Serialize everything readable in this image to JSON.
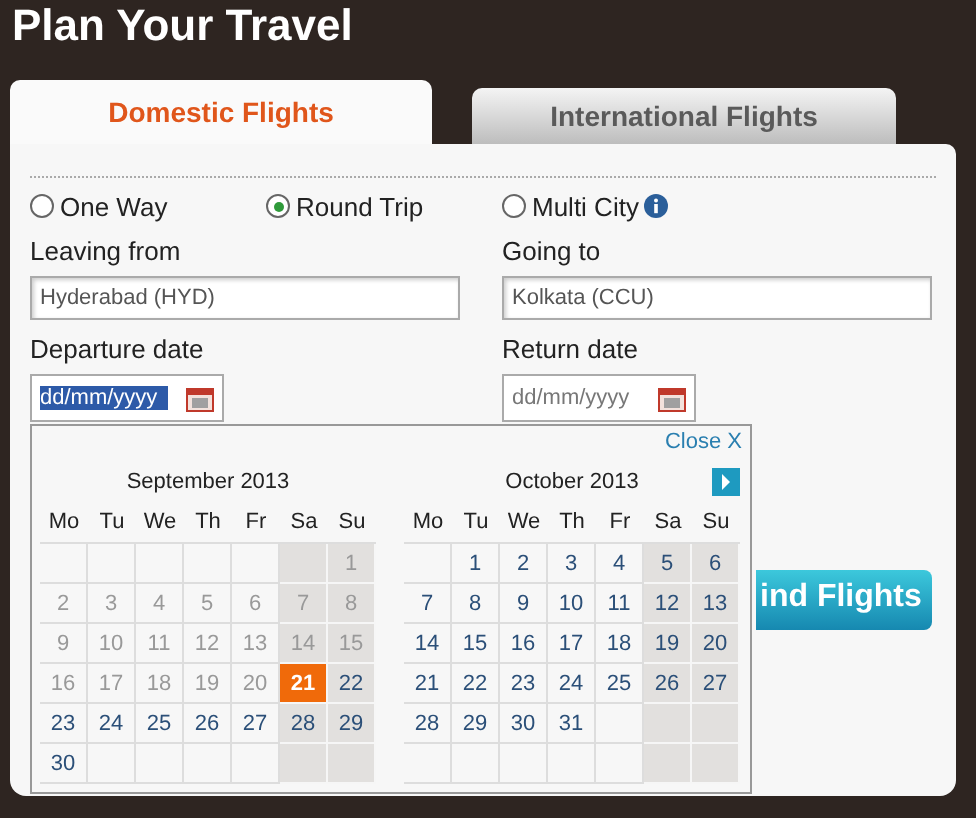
{
  "title": "Plan Your Travel",
  "tabs": [
    {
      "label": "Domestic Flights",
      "selected": true
    },
    {
      "label": "International Flights",
      "selected": false
    }
  ],
  "trip_types": [
    {
      "label": "One Way",
      "selected": false,
      "info": false
    },
    {
      "label": "Round Trip",
      "selected": true,
      "info": false
    },
    {
      "label": "Multi City",
      "selected": false,
      "info": true
    }
  ],
  "fields": [
    {
      "label": "Leaving from",
      "value": "Hyderabad (HYD)"
    },
    {
      "label": "Going to",
      "value": "Kolkata (CCU)"
    }
  ],
  "dates": [
    {
      "label": "Departure date",
      "placeholder": "dd/mm/yyyy",
      "focused": true
    },
    {
      "label": "Return date",
      "placeholder": "dd/mm/yyyy",
      "focused": false
    }
  ],
  "search_button": "ind Flights",
  "calendar": {
    "close": "Close X",
    "months": [
      {
        "title": "September 2013",
        "next": false,
        "weekdays": [
          "Mo",
          "Tu",
          "We",
          "Th",
          "Fr",
          "Sa",
          "Su"
        ],
        "weeks": [
          [
            {
              "kind": "blank"
            },
            {
              "kind": "blank"
            },
            {
              "kind": "blank"
            },
            {
              "kind": "blank"
            },
            {
              "kind": "blank"
            },
            {
              "kind": "blank"
            },
            {
              "day": "1",
              "kind": "past"
            }
          ],
          [
            {
              "day": "2",
              "kind": "past"
            },
            {
              "day": "3",
              "kind": "past"
            },
            {
              "day": "4",
              "kind": "past"
            },
            {
              "day": "5",
              "kind": "past"
            },
            {
              "day": "6",
              "kind": "past"
            },
            {
              "day": "7",
              "kind": "past"
            },
            {
              "day": "8",
              "kind": "past"
            }
          ],
          [
            {
              "day": "9",
              "kind": "past"
            },
            {
              "day": "10",
              "kind": "past"
            },
            {
              "day": "11",
              "kind": "past"
            },
            {
              "day": "12",
              "kind": "past"
            },
            {
              "day": "13",
              "kind": "past"
            },
            {
              "day": "14",
              "kind": "past"
            },
            {
              "day": "15",
              "kind": "past"
            }
          ],
          [
            {
              "day": "16",
              "kind": "past"
            },
            {
              "day": "17",
              "kind": "past"
            },
            {
              "day": "18",
              "kind": "past"
            },
            {
              "day": "19",
              "kind": "past"
            },
            {
              "day": "20",
              "kind": "past"
            },
            {
              "day": "21",
              "kind": "selected"
            },
            {
              "day": "22",
              "kind": "open"
            }
          ],
          [
            {
              "day": "23",
              "kind": "open"
            },
            {
              "day": "24",
              "kind": "open"
            },
            {
              "day": "25",
              "kind": "open"
            },
            {
              "day": "26",
              "kind": "open"
            },
            {
              "day": "27",
              "kind": "open"
            },
            {
              "day": "28",
              "kind": "open"
            },
            {
              "day": "29",
              "kind": "open"
            }
          ],
          [
            {
              "day": "30",
              "kind": "open"
            },
            {
              "kind": "blank"
            },
            {
              "kind": "blank"
            },
            {
              "kind": "blank"
            },
            {
              "kind": "blank"
            },
            {
              "kind": "blank"
            },
            {
              "kind": "blank"
            }
          ]
        ]
      },
      {
        "title": "October 2013",
        "next": true,
        "weekdays": [
          "Mo",
          "Tu",
          "We",
          "Th",
          "Fr",
          "Sa",
          "Su"
        ],
        "weeks": [
          [
            {
              "kind": "blank"
            },
            {
              "day": "1",
              "kind": "open"
            },
            {
              "day": "2",
              "kind": "open"
            },
            {
              "day": "3",
              "kind": "open"
            },
            {
              "day": "4",
              "kind": "open"
            },
            {
              "day": "5",
              "kind": "open"
            },
            {
              "day": "6",
              "kind": "open"
            }
          ],
          [
            {
              "day": "7",
              "kind": "open"
            },
            {
              "day": "8",
              "kind": "open"
            },
            {
              "day": "9",
              "kind": "open"
            },
            {
              "day": "10",
              "kind": "open"
            },
            {
              "day": "11",
              "kind": "open"
            },
            {
              "day": "12",
              "kind": "open"
            },
            {
              "day": "13",
              "kind": "open"
            }
          ],
          [
            {
              "day": "14",
              "kind": "open"
            },
            {
              "day": "15",
              "kind": "open"
            },
            {
              "day": "16",
              "kind": "open"
            },
            {
              "day": "17",
              "kind": "open"
            },
            {
              "day": "18",
              "kind": "open"
            },
            {
              "day": "19",
              "kind": "open"
            },
            {
              "day": "20",
              "kind": "open"
            }
          ],
          [
            {
              "day": "21",
              "kind": "open"
            },
            {
              "day": "22",
              "kind": "open"
            },
            {
              "day": "23",
              "kind": "open"
            },
            {
              "day": "24",
              "kind": "open"
            },
            {
              "day": "25",
              "kind": "open"
            },
            {
              "day": "26",
              "kind": "open"
            },
            {
              "day": "27",
              "kind": "open"
            }
          ],
          [
            {
              "day": "28",
              "kind": "open"
            },
            {
              "day": "29",
              "kind": "open"
            },
            {
              "day": "30",
              "kind": "open"
            },
            {
              "day": "31",
              "kind": "open"
            },
            {
              "kind": "blank"
            },
            {
              "kind": "blank"
            },
            {
              "kind": "blank"
            }
          ],
          [
            {
              "kind": "blank"
            },
            {
              "kind": "blank"
            },
            {
              "kind": "blank"
            },
            {
              "kind": "blank"
            },
            {
              "kind": "blank"
            },
            {
              "kind": "blank"
            },
            {
              "kind": "blank"
            }
          ]
        ]
      }
    ]
  }
}
